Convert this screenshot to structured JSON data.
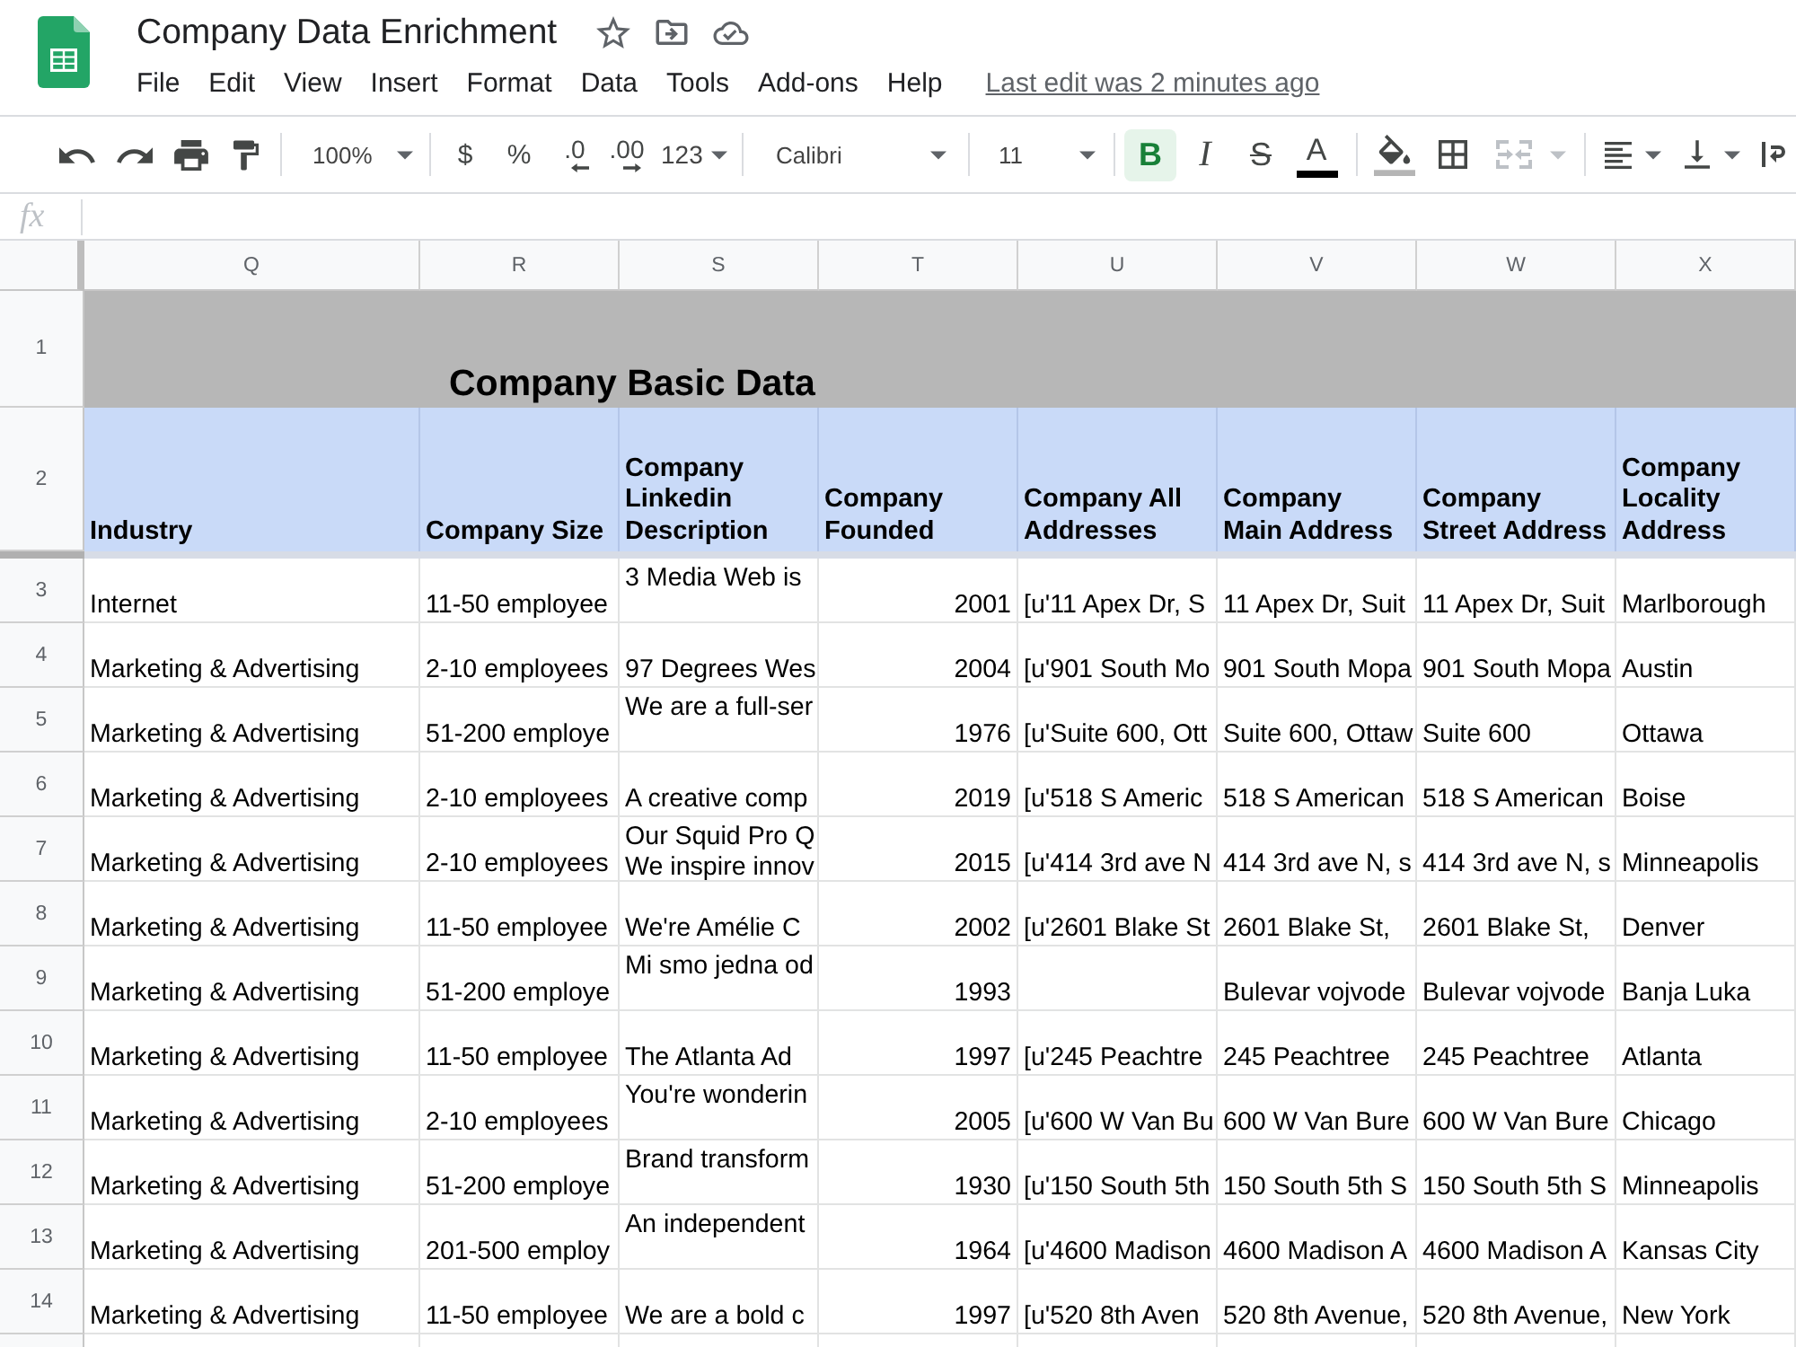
{
  "app": {
    "title": "Company Data Enrichment",
    "menu": [
      "File",
      "Edit",
      "View",
      "Insert",
      "Format",
      "Data",
      "Tools",
      "Add-ons",
      "Help"
    ],
    "last_edit": "Last edit was 2 minutes ago"
  },
  "toolbar": {
    "zoom": "100%",
    "currency": "$",
    "percent": "%",
    "decrease_decimals": ".0",
    "increase_decimals": ".00",
    "more_formats": "123",
    "font": "Calibri",
    "font_size": "11",
    "styles": [
      {
        "kind": "bold",
        "label": "B",
        "on": true
      },
      {
        "kind": "italic",
        "label": "I",
        "on": false
      },
      {
        "kind": "strikethrough",
        "label": "S",
        "on": false
      }
    ],
    "text_color": "A",
    "merge": {
      "disabled": true
    }
  },
  "formula_bar": {
    "label": "fx"
  },
  "sheet": {
    "columns": [
      "Q",
      "R",
      "S",
      "T",
      "U",
      "V",
      "W",
      "X"
    ],
    "title_row": {
      "number": "1",
      "title": "Company Basic Data"
    },
    "header_row": {
      "number": "2",
      "headers": [
        "Industry",
        "Company Size",
        "Company Linkedin Description",
        "Company Founded",
        "Company All Addresses",
        "Company Main Address",
        "Company Street Address",
        "Company Locality Address"
      ]
    },
    "rows": [
      {
        "number": "3",
        "industry": "Internet",
        "size": "11-50 employee",
        "description": "3 Media Web is",
        "description_wrapped": true,
        "founded": "2001",
        "all_addresses": "[u'11 Apex Dr, S",
        "main_address": "11 Apex Dr, Suit",
        "street_address": "11 Apex Dr, Suit",
        "locality": "Marlborough"
      },
      {
        "number": "4",
        "industry": "Marketing & Advertising",
        "size": "2-10 employees",
        "description": "97 Degrees Wes",
        "description_wrapped": false,
        "founded": "2004",
        "all_addresses": "[u'901 South Mo",
        "main_address": "901 South Mopa",
        "street_address": "901 South Mopa",
        "locality": "Austin"
      },
      {
        "number": "5",
        "industry": "Marketing & Advertising",
        "size": "51-200 employe",
        "description": "We are a full-ser",
        "description_wrapped": true,
        "founded": "1976",
        "all_addresses": "[u'Suite 600, Ott",
        "main_address": "Suite 600, Ottaw",
        "street_address": "Suite 600",
        "locality": "Ottawa"
      },
      {
        "number": "6",
        "industry": "Marketing & Advertising",
        "size": "2-10 employees",
        "description": "A creative comp",
        "description_wrapped": false,
        "founded": "2019",
        "all_addresses": "[u'518 S Americ",
        "main_address": "518 S American",
        "street_address": "518 S American",
        "locality": "Boise"
      },
      {
        "number": "7",
        "industry": "Marketing & Advertising",
        "size": "2-10 employees",
        "description": "Our Squid Pro Q\nWe inspire innov",
        "description_wrapped": true,
        "founded": "2015",
        "all_addresses": "[u'414 3rd ave N",
        "main_address": "414 3rd ave N, s",
        "street_address": "414 3rd ave N, s",
        "locality": "Minneapolis"
      },
      {
        "number": "8",
        "industry": "Marketing & Advertising",
        "size": "11-50 employee",
        "description": "We're Amélie C",
        "description_wrapped": false,
        "founded": "2002",
        "all_addresses": "[u'2601 Blake St",
        "main_address": "2601 Blake St,",
        "street_address": "2601 Blake St,",
        "locality": "Denver"
      },
      {
        "number": "9",
        "industry": "Marketing & Advertising",
        "size": "51-200 employe",
        "description": "Mi smo jedna od",
        "description_wrapped": true,
        "founded": "1993",
        "main_address": "Bulevar vojvode",
        "street_address": "Bulevar vojvode",
        "locality": "Banja Luka"
      },
      {
        "number": "10",
        "industry": "Marketing & Advertising",
        "size": "11-50 employee",
        "description": "The Atlanta Ad",
        "description_wrapped": false,
        "founded": "1997",
        "all_addresses": "[u'245 Peachtre",
        "main_address": "245 Peachtree",
        "street_address": "245 Peachtree",
        "locality": "Atlanta"
      },
      {
        "number": "11",
        "industry": "Marketing & Advertising",
        "size": "2-10 employees",
        "description": "You're wonderin",
        "description_wrapped": true,
        "founded": "2005",
        "all_addresses": "[u'600 W Van Bu",
        "main_address": "600 W Van Bure",
        "street_address": "600 W Van Bure",
        "locality": "Chicago"
      },
      {
        "number": "12",
        "industry": "Marketing & Advertising",
        "size": "51-200 employe",
        "description": "Brand transform",
        "description_wrapped": true,
        "founded": "1930",
        "all_addresses": "[u'150 South 5th",
        "main_address": "150 South 5th S",
        "street_address": "150 South 5th S",
        "locality": "Minneapolis"
      },
      {
        "number": "13",
        "industry": "Marketing & Advertising",
        "size": "201-500 employ",
        "description": "An independent",
        "description_wrapped": true,
        "founded": "1964",
        "all_addresses": "[u'4600 Madison",
        "main_address": "4600 Madison A",
        "street_address": "4600 Madison A",
        "locality": "Kansas City"
      },
      {
        "number": "14",
        "industry": "Marketing & Advertising",
        "size": "11-50 employee",
        "description": "We are a bold c",
        "description_wrapped": false,
        "founded": "1997",
        "all_addresses": "[u'520 8th Aven",
        "main_address": "520 8th Avenue,",
        "street_address": "520 8th Avenue,",
        "locality": "New York"
      }
    ]
  }
}
